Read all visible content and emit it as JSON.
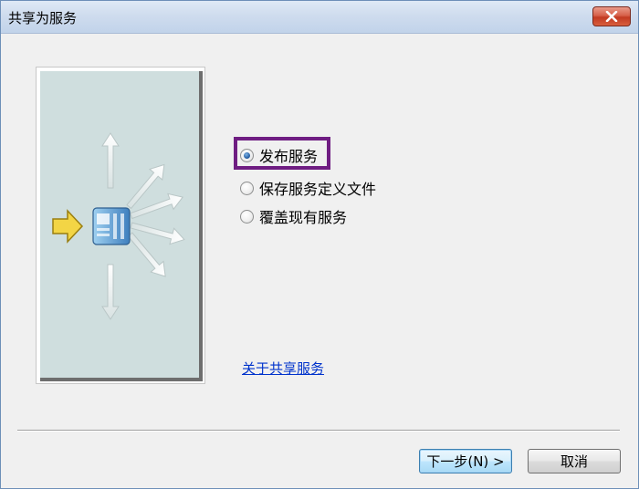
{
  "window": {
    "title": "共享为服务",
    "close_icon": "close-icon"
  },
  "options": [
    {
      "label": "发布服务",
      "selected": true
    },
    {
      "label": "保存服务定义文件",
      "selected": false
    },
    {
      "label": "覆盖现有服务",
      "selected": false
    }
  ],
  "link": {
    "label": "关于共享服务"
  },
  "buttons": {
    "next_label": "下一步(N) >",
    "cancel_label": "取消"
  },
  "illustration": {
    "icon": "share-service-illustration",
    "colors": {
      "panel": "#cfdede",
      "arrow_in": "#e8c83a",
      "server": "#4a8bc8"
    }
  },
  "colors": {
    "focus_border": "#6f1d82",
    "link": "#0033cc",
    "titlebar": "#cfdcee"
  }
}
